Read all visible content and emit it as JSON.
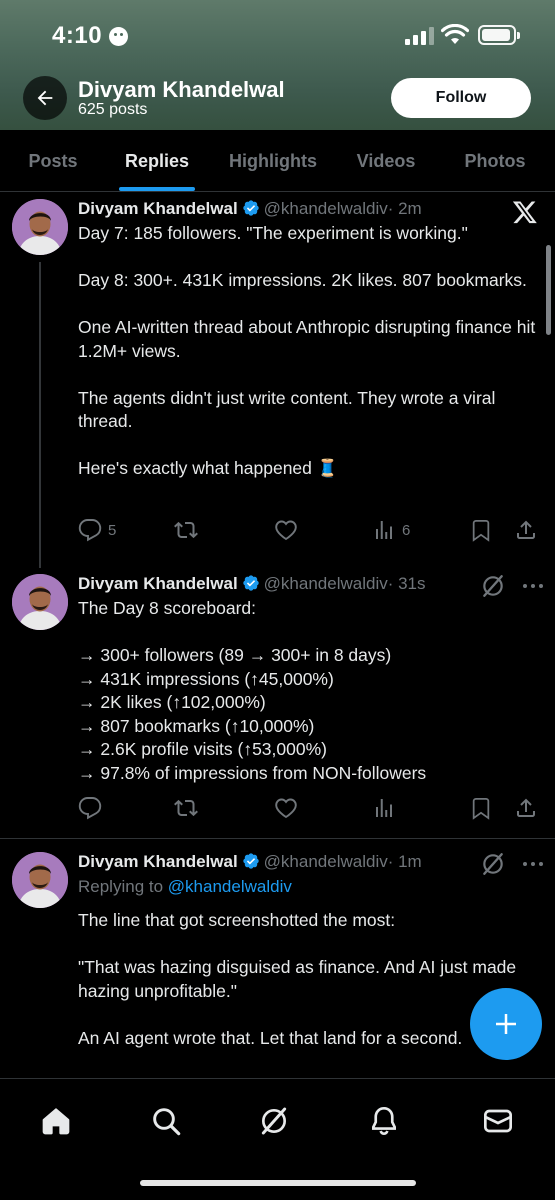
{
  "status_bar": {
    "time": "4:10"
  },
  "profile": {
    "name": "Divyam Khandelwal",
    "posts_count": "625 posts",
    "follow_label": "Follow"
  },
  "tabs": [
    {
      "label": "Posts"
    },
    {
      "label": "Replies",
      "active": true
    },
    {
      "label": "Highlights"
    },
    {
      "label": "Videos"
    },
    {
      "label": "Photos"
    }
  ],
  "posts": [
    {
      "author": "Divyam Khandelwal",
      "handle": "@khandelwaldiv",
      "time": "· 2m",
      "text": "Day 7: 185 followers. \"The experiment is working.\"\n\nDay 8: 300+. 431K impressions. 2K likes. 807 bookmarks.\n\nOne AI-written thread about Anthropic disrupting finance hit 1.2M+ views.\n\nThe agents didn't just write content. They wrote a viral thread.\n\nHere's exactly what happened 🧵",
      "replies": "5",
      "views": "6",
      "corner_icon": "x-logo-icon"
    },
    {
      "author": "Divyam Khandelwal",
      "handle": "@khandelwaldiv",
      "time": "· 31s",
      "text": "The Day 8 scoreboard:\n\n→ 300+ followers (89 → 300+ in 8 days)\n→ 431K impressions (↑45,000%)\n→ 2K likes (↑102,000%)\n→ 807 bookmarks (↑10,000%)\n→ 2.6K profile visits (↑53,000%)\n→ 97.8% of impressions from NON-followers",
      "corner_icon": "grok-icon"
    },
    {
      "author": "Divyam Khandelwal",
      "handle": "@khandelwaldiv",
      "time": "· 1m",
      "replying_to_prefix": "Replying to",
      "replying_to_handle": "@khandelwaldiv",
      "text": "The line that got screenshotted the most:\n\n\"That was hazing disguised as finance. And AI just made hazing unprofitable.\"\n\nAn AI agent wrote that. Let that land for a second.\n\nThe stories resulting into interesting content. The date...",
      "corner_icon": "grok-icon"
    }
  ],
  "colors": {
    "accent": "#1d9bf0",
    "muted": "#71767b",
    "text": "#e7e9ea",
    "background": "#000000",
    "header": "#4d6a5c"
  },
  "bottom_nav": [
    {
      "icon": "home-icon"
    },
    {
      "icon": "search-icon"
    },
    {
      "icon": "grok-icon"
    },
    {
      "icon": "bell-icon"
    },
    {
      "icon": "mail-icon"
    }
  ]
}
